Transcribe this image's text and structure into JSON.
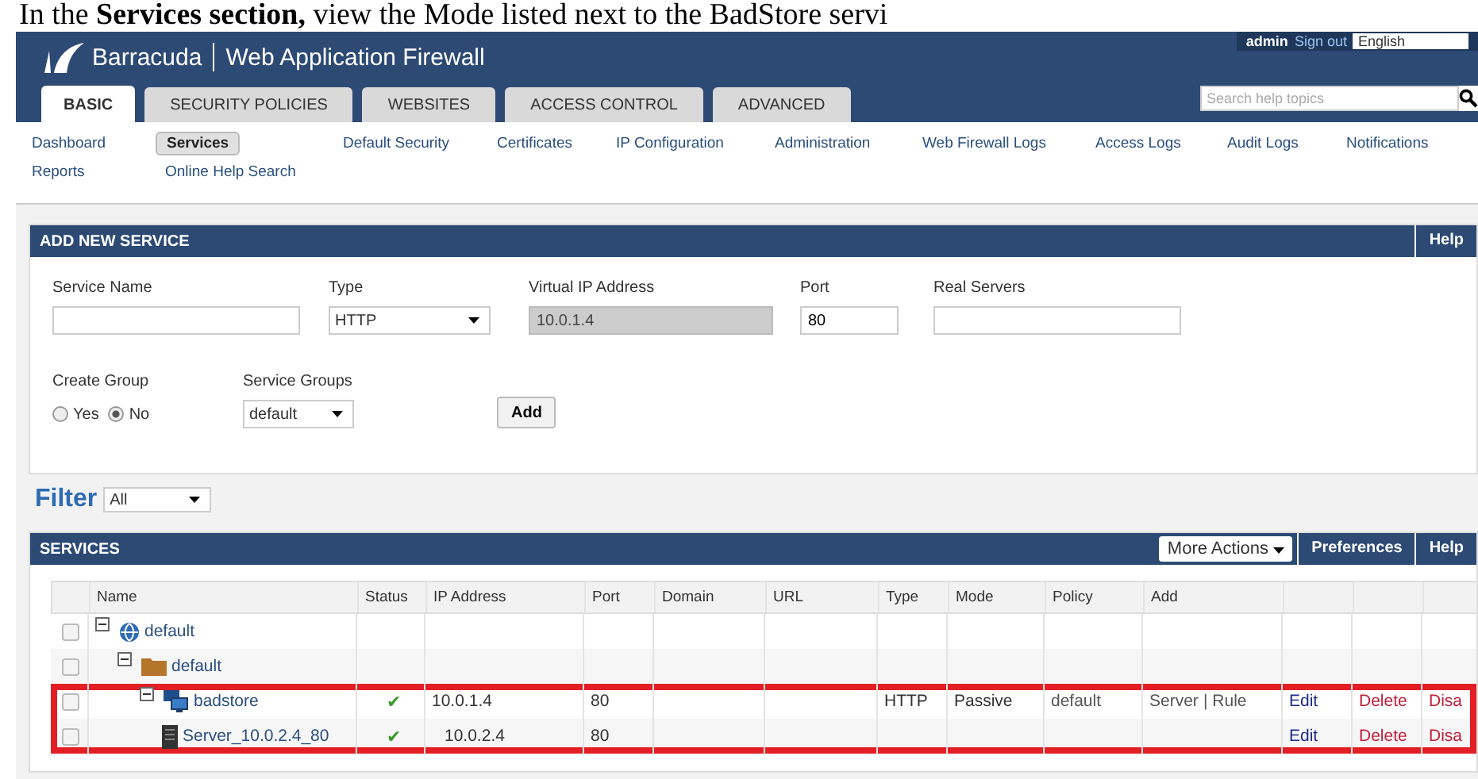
{
  "instruction": "In the **Services section,** view the Mode listed next to the BadStore servi",
  "header": {
    "brand": "Barracuda",
    "product": "Web Application Firewall",
    "user": "admin",
    "sign_out": "Sign out",
    "language": "English",
    "search": {
      "placeholder": "Search help topics"
    }
  },
  "tabs": [
    {
      "label": "BASIC",
      "selected": true
    },
    {
      "label": "SECURITY POLICIES",
      "selected": false
    },
    {
      "label": "WEBSITES",
      "selected": false
    },
    {
      "label": "ACCESS CONTROL",
      "selected": false
    },
    {
      "label": "ADVANCED",
      "selected": false
    }
  ],
  "subnav": [
    [
      {
        "label": "Dashboard",
        "selected": false
      },
      {
        "label": "Services",
        "selected": true
      },
      {
        "label": "Default Security",
        "selected": false
      },
      {
        "label": "Certificates",
        "selected": false
      },
      {
        "label": "IP Configuration",
        "selected": false
      },
      {
        "label": "Administration",
        "selected": false
      },
      {
        "label": "Web Firewall Logs",
        "selected": false
      },
      {
        "label": "Access Logs",
        "selected": false
      },
      {
        "label": "Audit Logs",
        "selected": false
      },
      {
        "label": "Notifications",
        "selected": false
      }
    ],
    [
      {
        "label": "Reports",
        "selected": false
      },
      {
        "label": "Online Help Search",
        "selected": false
      }
    ]
  ],
  "add_service": {
    "title": "ADD NEW SERVICE",
    "help": "Help",
    "fields": [
      {
        "label": "Service Name",
        "kind": "text"
      },
      {
        "label": "Type",
        "kind": "select",
        "value": "HTTP"
      },
      {
        "label": "Virtual IP Address",
        "kind": "readonly",
        "value": "10.0.1.4"
      },
      {
        "label": "Port",
        "kind": "text",
        "value": "80"
      },
      {
        "label": "Real Servers",
        "kind": "text"
      }
    ],
    "create_group": {
      "label": "Create Group",
      "options": [
        {
          "label": "Yes",
          "selected": false
        },
        {
          "label": "No",
          "selected": true
        }
      ]
    },
    "service_groups": {
      "label": "Service Groups",
      "value": "default"
    },
    "add_button": "Add"
  },
  "filter": {
    "label": "Filter",
    "value": "All"
  },
  "services": {
    "title": "SERVICES",
    "more_actions": "More Actions",
    "preferences": "Preferences",
    "help": "Help",
    "columns": [
      "Name",
      "Status",
      "IP Address",
      "Port",
      "Domain",
      "URL",
      "Type",
      "Mode",
      "Policy",
      "Add"
    ],
    "rows": [
      {
        "kind": "group",
        "name": "default",
        "checked": false,
        "highlighted": false,
        "children": [
          {
            "kind": "folder",
            "name": "default",
            "checked": false,
            "highlighted": false,
            "children": [
              {
                "kind": "service",
                "name": "badstore",
                "checked": false,
                "highlighted": true,
                "status": "✔",
                "ip": "10.0.1.4",
                "port": "80",
                "type": "HTTP",
                "mode": "Passive",
                "policy": "default",
                "add": [
                  "Server",
                  "|",
                  "Rule"
                ],
                "actions": [
                  "Edit",
                  "Delete",
                  "Disa"
                ],
                "children": [
                  {
                    "kind": "server",
                    "name": "Server_10.0.2.4_80",
                    "checked": false,
                    "highlighted": true,
                    "status": "✔",
                    "ip": "10.0.2.4",
                    "port": "80",
                    "actions": [
                      "Edit",
                      "Delete",
                      "Disa"
                    ]
                  }
                ]
              }
            ]
          }
        ]
      }
    ]
  }
}
